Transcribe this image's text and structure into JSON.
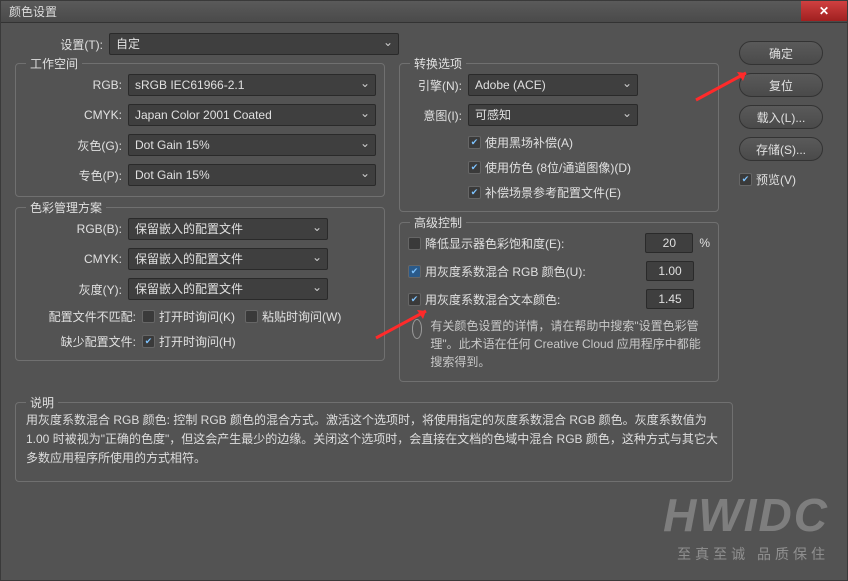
{
  "window": {
    "title": "颜色设置"
  },
  "settings": {
    "label": "设置(T):",
    "value": "自定"
  },
  "workspace": {
    "legend": "工作空间",
    "rgb": {
      "label": "RGB:",
      "value": "sRGB IEC61966-2.1"
    },
    "cmyk": {
      "label": "CMYK:",
      "value": "Japan Color 2001 Coated"
    },
    "gray": {
      "label": "灰色(G):",
      "value": "Dot Gain 15%"
    },
    "spot": {
      "label": "专色(P):",
      "value": "Dot Gain 15%"
    }
  },
  "cmm": {
    "legend": "色彩管理方案",
    "rgb": {
      "label": "RGB(B):",
      "value": "保留嵌入的配置文件"
    },
    "cmyk": {
      "label": "CMYK:",
      "value": "保留嵌入的配置文件"
    },
    "gray": {
      "label": "灰度(Y):",
      "value": "保留嵌入的配置文件"
    },
    "mismatch": {
      "label": "配置文件不匹配:",
      "open": "打开时询问(K)",
      "paste": "粘贴时询问(W)"
    },
    "missing": {
      "label": "缺少配置文件:",
      "open": "打开时询问(H)"
    }
  },
  "convert": {
    "legend": "转换选项",
    "engine": {
      "label": "引擎(N):",
      "value": "Adobe (ACE)"
    },
    "intent": {
      "label": "意图(I):",
      "value": "可感知"
    },
    "blackpoint": "使用黑场补偿(A)",
    "dither": "使用仿色 (8位/通道图像)(D)",
    "scene": "补偿场景参考配置文件(E)"
  },
  "advanced": {
    "legend": "高级控制",
    "desaturate": {
      "label": "降低显示器色彩饱和度(E):",
      "value": "20",
      "unit": "%"
    },
    "blend_rgb": {
      "label": "用灰度系数混合 RGB 颜色(U):",
      "value": "1.00"
    },
    "blend_text": {
      "label": "用灰度系数混合文本颜色:",
      "value": "1.45"
    },
    "hint": "有关颜色设置的详情，请在帮助中搜索\"设置色彩管理\"。此术语在任何 Creative Cloud 应用程序中都能搜索得到。"
  },
  "buttons": {
    "ok": "确定",
    "reset": "复位",
    "load": "载入(L)...",
    "save": "存储(S)...",
    "preview": "预览(V)"
  },
  "description": {
    "legend": "说明",
    "text": "用灰度系数混合 RGB 颜色: 控制 RGB 颜色的混合方式。激活这个选项时，将使用指定的灰度系数混合 RGB 颜色。灰度系数值为 1.00 时被视为\"正确的色度\"，但这会产生最少的边缘。关闭这个选项时，会直接在文档的色域中混合 RGB 颜色，这种方式与其它大多数应用程序所使用的方式相符。"
  },
  "watermark": {
    "big": "HWIDC",
    "small": "至真至诚 品质保住"
  },
  "chart_data": null
}
